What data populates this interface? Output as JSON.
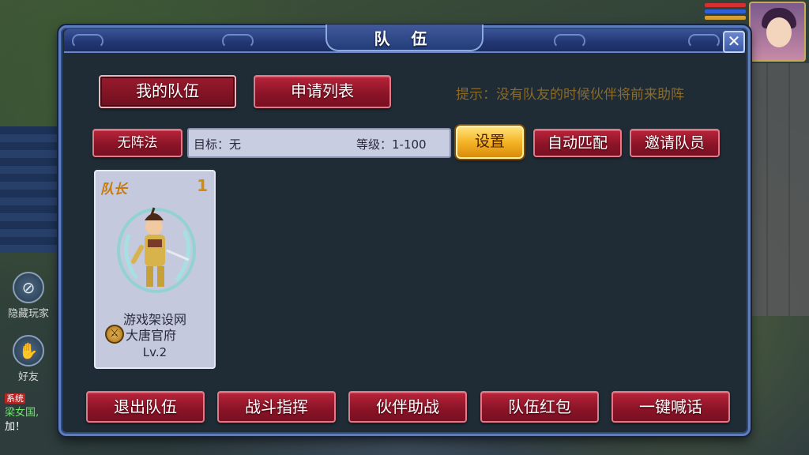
{
  "dialog": {
    "title": "队 伍",
    "close_label": "✕"
  },
  "tabs": [
    {
      "label": "我的队伍",
      "active": true
    },
    {
      "label": "申请列表",
      "active": false
    }
  ],
  "hint": "提示：没有队友的时候伙伴将前来助阵",
  "formation_button": "无阵法",
  "target": {
    "goal_label": "目标：无",
    "level_label": "等级：1-100"
  },
  "actions": {
    "settings": "设置",
    "auto_match": "自动匹配",
    "invite": "邀请队员"
  },
  "member": {
    "role": "队长",
    "number": "1",
    "name": "游戏架设网",
    "school": "大唐官府",
    "level": "Lv.2"
  },
  "bottom_buttons": [
    "退出队伍",
    "战斗指挥",
    "伙伴助战",
    "队伍红包",
    "一键喊话"
  ],
  "hud": {
    "left_icons": [
      {
        "label": "隐藏玩家",
        "icon": "hide-icon"
      },
      {
        "label": "好友",
        "icon": "handshake-icon"
      }
    ],
    "chat": {
      "channel_tag": "系统",
      "line1": "梁女国,",
      "line2": "加！"
    }
  },
  "colors": {
    "dialog_bg": "#1f2c36",
    "button_red": "#8c1427",
    "button_gold": "#f5b326",
    "hint_text": "#8a6a2a",
    "card_bg": "#c4c9de"
  }
}
